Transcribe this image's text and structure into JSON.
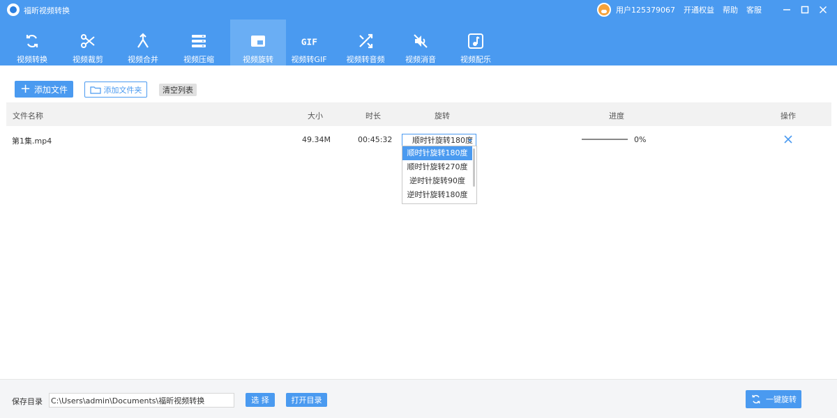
{
  "app": {
    "title": "福昕视频转换"
  },
  "titlebar": {
    "user": "用户125379067",
    "links": [
      "开通权益",
      "帮助",
      "客服"
    ]
  },
  "toolbar": {
    "items": [
      {
        "label": "视频转换",
        "icon": "refresh-icon"
      },
      {
        "label": "视频裁剪",
        "icon": "scissors-icon"
      },
      {
        "label": "视频合并",
        "icon": "merge-icon"
      },
      {
        "label": "视频压缩",
        "icon": "compress-icon"
      },
      {
        "label": "视频旋转",
        "icon": "rotate-icon",
        "active": true
      },
      {
        "label": "视频转GIF",
        "icon": "gif-icon"
      },
      {
        "label": "视频转音频",
        "icon": "shuffle-icon"
      },
      {
        "label": "视频消音",
        "icon": "mute-icon"
      },
      {
        "label": "视频配乐",
        "icon": "music-icon"
      }
    ]
  },
  "actions": {
    "add_file": "添加文件",
    "add_folder": "添加文件夹",
    "clear_list": "清空列表"
  },
  "table": {
    "headers": {
      "name": "文件名称",
      "size": "大小",
      "duration": "时长",
      "rotate": "旋转",
      "progress": "进度",
      "action": "操作"
    },
    "rows": [
      {
        "name": "第1集.mp4",
        "size": "49.34M",
        "duration": "00:45:32",
        "rotation": "顺时针旋转180度",
        "progress": "0%"
      }
    ]
  },
  "dropdown": {
    "options": [
      "顺时针旋转180度",
      "顺时针旋转270度",
      "逆时针旋转90度",
      "逆时针旋转180度"
    ],
    "highlighted": "顺时针旋转180度"
  },
  "footer": {
    "save_label": "保存目录",
    "path": "C:\\Users\\admin\\Documents\\福昕视频转换",
    "choose": "选 择",
    "open_dir": "打开目录",
    "rotate_all": "一键旋转"
  },
  "colors": {
    "accent": "#4a9af0",
    "toolbar_active": "#6aaef4"
  }
}
